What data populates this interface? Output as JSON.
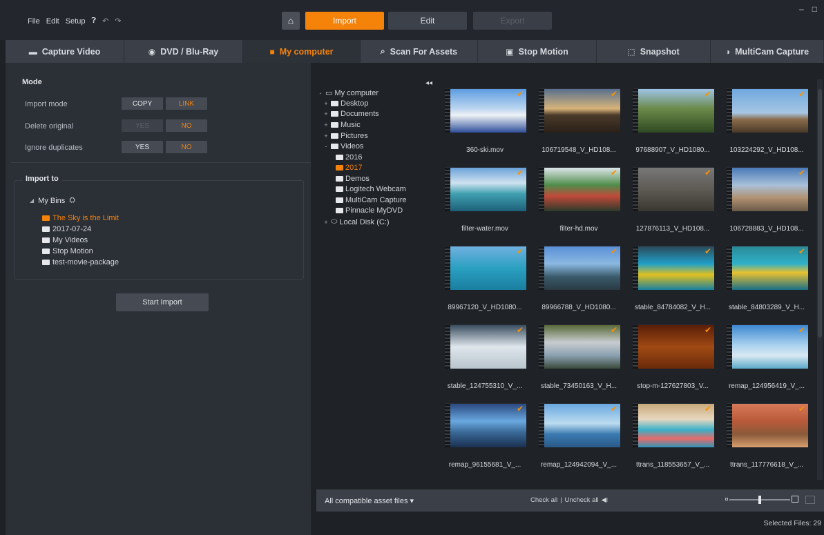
{
  "menu": {
    "file": "File",
    "edit": "Edit",
    "setup": "Setup"
  },
  "modes": {
    "import": "Import",
    "edit": "Edit",
    "export": "Export"
  },
  "tabs": [
    {
      "label": "Capture Video",
      "icon": "camera-icon"
    },
    {
      "label": "DVD / Blu-Ray",
      "icon": "disc-icon"
    },
    {
      "label": "My computer",
      "icon": "folder-icon"
    },
    {
      "label": "Scan For Assets",
      "icon": "search-icon"
    },
    {
      "label": "Stop Motion",
      "icon": "stop-motion-icon"
    },
    {
      "label": "Snapshot",
      "icon": "snapshot-icon"
    },
    {
      "label": "MultiCam Capture",
      "icon": "multicam-icon"
    }
  ],
  "mode_section": {
    "title": "Mode",
    "import_mode": {
      "label": "Import mode",
      "a": "COPY",
      "b": "LINK"
    },
    "delete_original": {
      "label": "Delete original",
      "a": "YES",
      "b": "NO"
    },
    "ignore_duplicates": {
      "label": "Ignore duplicates",
      "a": "YES",
      "b": "NO"
    }
  },
  "import_to": {
    "title": "Import to",
    "root": "My Bins",
    "bins": [
      "The Sky is the Limit",
      "2017-07-24",
      "My Videos",
      "Stop Motion",
      "test-movie-package"
    ]
  },
  "start_import": "Start Import",
  "tree": {
    "root": "My computer",
    "desktop": "Desktop",
    "documents": "Documents",
    "music": "Music",
    "pictures": "Pictures",
    "videos": "Videos",
    "y2016": "2016",
    "y2017": "2017",
    "demos": "Demos",
    "logitech": "Logitech Webcam",
    "multicam": "MultiCam Capture",
    "pinnacle": "Pinnacle MyDVD",
    "localdisk": "Local Disk (C:)"
  },
  "files": [
    "360-ski.mov",
    "106719548_V_HD108...",
    "97688907_V_HD1080...",
    "103224292_V_HD108...",
    "filter-water.mov",
    "filter-hd.mov",
    "127876113_V_HD108...",
    "106728883_V_HD108...",
    "89967120_V_HD1080...",
    "89966788_V_HD1080...",
    "stable_84784082_V_H...",
    "stable_84803289_V_H...",
    "stable_124755310_V_...",
    "stable_73450163_V_H...",
    "stop-m-127627803_V...",
    "remap_124956419_V_...",
    "remap_96155681_V_...",
    "remap_124942094_V_...",
    "ttrans_118553657_V_...",
    "ttrans_117776618_V_..."
  ],
  "bottom": {
    "filter": "All compatible asset files",
    "check_all": "Check all",
    "uncheck_all": "Uncheck all",
    "selected": "Selected Files: 29"
  },
  "colors": {
    "accent": "#f5830a",
    "panel": "#2b2f36",
    "background": "#1e2126"
  }
}
